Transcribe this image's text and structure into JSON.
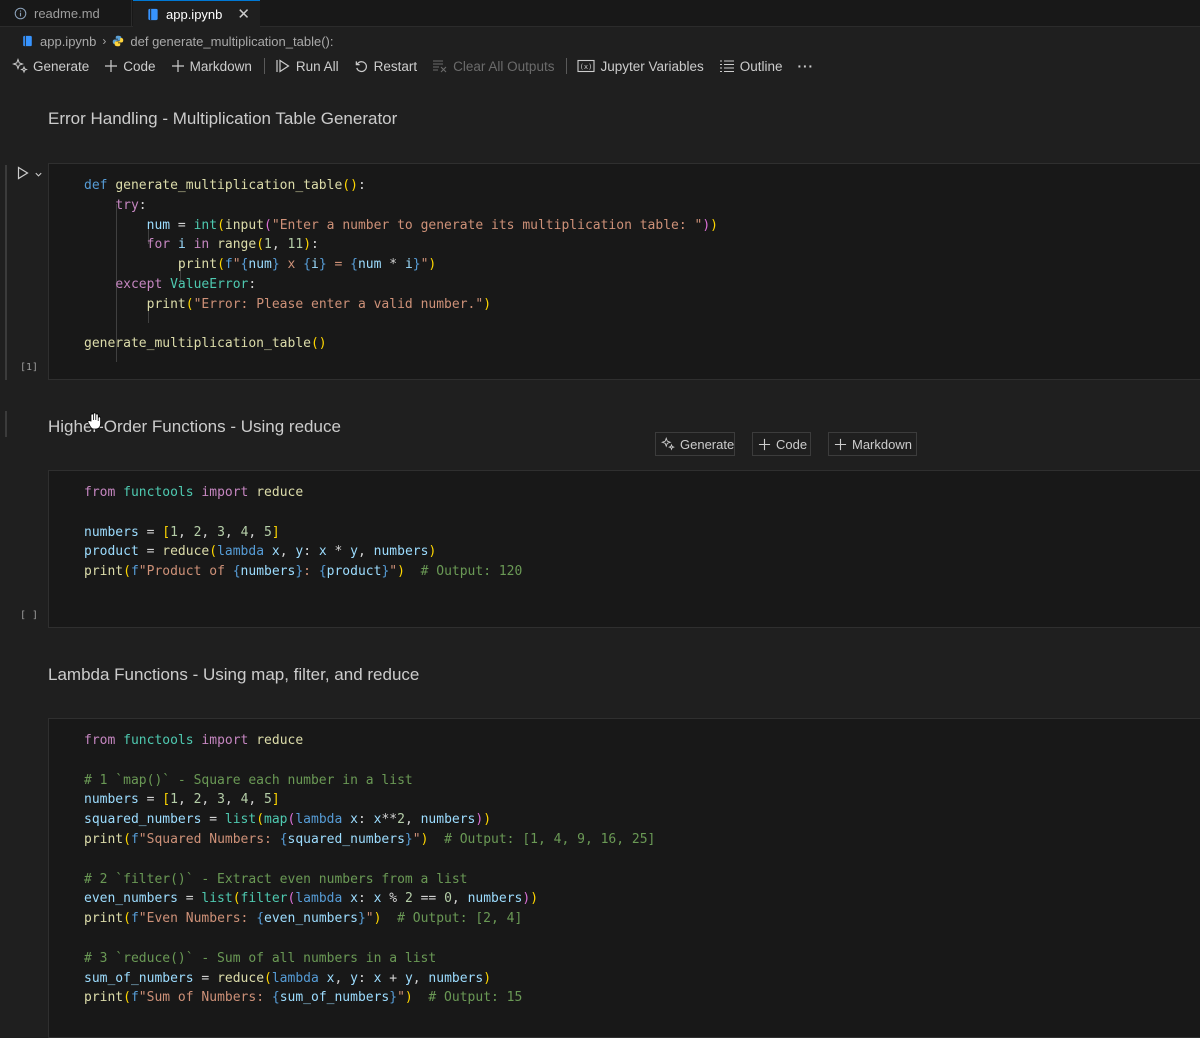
{
  "tabs": [
    {
      "label": "readme.md",
      "icon": "info-icon",
      "active": false
    },
    {
      "label": "app.ipynb",
      "icon": "notebook-icon",
      "active": true
    }
  ],
  "breadcrumb": {
    "file": "app.ipynb",
    "symbol": "def generate_multiplication_table():"
  },
  "toolbar": {
    "generate": "Generate",
    "code": "Code",
    "markdown": "Markdown",
    "run_all": "Run All",
    "restart": "Restart",
    "clear_all_outputs": "Clear All Outputs",
    "jupyter_variables": "Jupyter Variables",
    "outline": "Outline",
    "more": "···"
  },
  "cells": {
    "md1": "Error Handling - Multiplication Table Generator",
    "exec1": "[1]",
    "md2": "Higher-Order Functions - Using reduce",
    "exec2": "[ ]",
    "md3": "Lambda Functions - Using map, filter, and reduce",
    "code1": [
      "def generate_multiplication_table():",
      "    try:",
      "        num = int(input(\"Enter a number to generate its multiplication table: \"))",
      "        for i in range(1, 11):",
      "            print(f\"{num} x {i} = {num * i}\")",
      "    except ValueError:",
      "        print(\"Error: Please enter a valid number.\")",
      "",
      "generate_multiplication_table()"
    ],
    "code2": [
      "from functools import reduce",
      "",
      "numbers = [1, 2, 3, 4, 5]",
      "product = reduce(lambda x, y: x * y, numbers)",
      "print(f\"Product of {numbers}: {product}\")  # Output: 120"
    ],
    "code3": [
      "from functools import reduce",
      "",
      "# 1 `map()` - Square each number in a list",
      "numbers = [1, 2, 3, 4, 5]",
      "squared_numbers = list(map(lambda x: x**2, numbers))",
      "print(f\"Squared Numbers: {squared_numbers}\")  # Output: [1, 4, 9, 16, 25]",
      "",
      "# 2 `filter()` - Extract even numbers from a list",
      "even_numbers = list(filter(lambda x: x % 2 == 0, numbers))",
      "print(f\"Even Numbers: {even_numbers}\")  # Output: [2, 4]",
      "",
      "# 3 `reduce()` - Sum of all numbers in a list",
      "sum_of_numbers = reduce(lambda x, y: x + y, numbers)",
      "print(f\"Sum of Numbers: {sum_of_numbers}\")  # Output: 15"
    ]
  },
  "insert_bar": {
    "generate": "Generate",
    "code": "Code",
    "markdown": "Markdown"
  }
}
